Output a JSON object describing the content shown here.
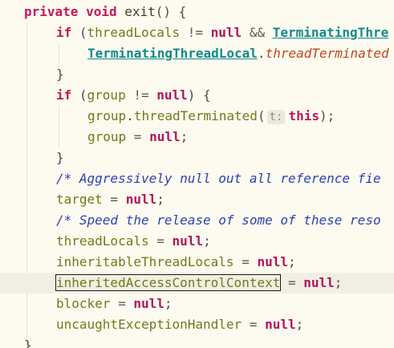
{
  "code": {
    "l1": {
      "kw1": "private",
      "kw2": "void",
      "name": "exit",
      "rest": "() {"
    },
    "l2": {
      "kw": "if",
      "p1": " (",
      "var": "threadLocals",
      "op": " != ",
      "nul": "null",
      "and": " && ",
      "cls": "TerminatingThre"
    },
    "l3": {
      "cls": "TerminatingThreadLocal",
      "dot": ".",
      "fn": "threadTerminated"
    },
    "l4": {
      "brace": "}"
    },
    "l5": {
      "kw": "if",
      "p1": " (",
      "var": "group",
      "op": " != ",
      "nul": "null",
      "p2": ") {"
    },
    "l6": {
      "var": "group",
      "dot": ".",
      "method": "threadTerminated",
      "p1": "(",
      "hint": "t:",
      "this": "this",
      "p2": ");"
    },
    "l7": {
      "var": "group",
      "op": " = ",
      "nul": "null",
      "semi": ";"
    },
    "l8": {
      "brace": "}"
    },
    "l9": {
      "cmt": "/* Aggressively null out all reference fie"
    },
    "l10": {
      "var": "target",
      "op": " = ",
      "nul": "null",
      "semi": ";"
    },
    "l11": {
      "cmt": "/* Speed the release of some of these reso"
    },
    "l12": {
      "var": "threadLocals",
      "op": " = ",
      "nul": "null",
      "semi": ";"
    },
    "l13": {
      "var": "inheritableThreadLocals",
      "op": " = ",
      "nul": "null",
      "semi": ";"
    },
    "l14": {
      "var": "inheritedAccessControlContext",
      "op": " = ",
      "nul": "null",
      "semi": ";"
    },
    "l15": {
      "var": "blocker",
      "op": " = ",
      "nul": "null",
      "semi": ";"
    },
    "l16": {
      "var": "uncaughtExceptionHandler",
      "op": " = ",
      "nul": "null",
      "semi": ";"
    },
    "l17": {
      "brace": "}"
    }
  }
}
